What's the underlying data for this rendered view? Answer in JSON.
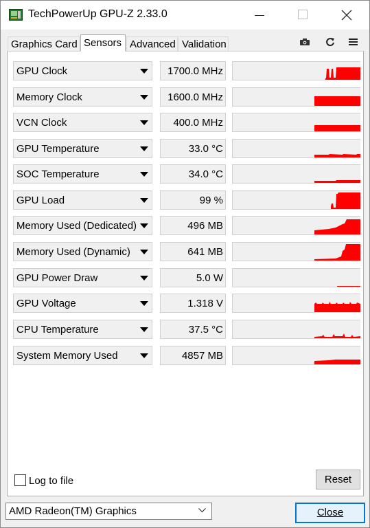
{
  "window": {
    "title": "TechPowerUp GPU-Z 2.33.0",
    "icon": "gpu-card-icon"
  },
  "tabs": [
    {
      "label": "Graphics Card",
      "active": false
    },
    {
      "label": "Sensors",
      "active": true
    },
    {
      "label": "Advanced",
      "active": false
    },
    {
      "label": "Validation",
      "active": false
    }
  ],
  "header_icons": [
    "camera-icon",
    "refresh-icon",
    "menu-icon"
  ],
  "sensors": [
    {
      "name": "GPU Clock",
      "value": "1700.0 MHz"
    },
    {
      "name": "Memory Clock",
      "value": "1600.0 MHz"
    },
    {
      "name": "VCN Clock",
      "value": "400.0 MHz"
    },
    {
      "name": "GPU Temperature",
      "value": "33.0 °C"
    },
    {
      "name": "SOC Temperature",
      "value": "34.0 °C"
    },
    {
      "name": "GPU Load",
      "value": "99 %"
    },
    {
      "name": "Memory Used (Dedicated)",
      "value": "496 MB"
    },
    {
      "name": "Memory Used (Dynamic)",
      "value": "641 MB"
    },
    {
      "name": "GPU Power Draw",
      "value": "5.0 W"
    },
    {
      "name": "GPU Voltage",
      "value": "1.318 V"
    },
    {
      "name": "CPU Temperature",
      "value": "37.5 °C"
    },
    {
      "name": "System Memory Used",
      "value": "4857 MB"
    }
  ],
  "graph_color": "#ff0000",
  "log_to_file": {
    "label": "Log to file",
    "checked": false
  },
  "reset_label": "Reset",
  "gpu_select": {
    "value": "AMD Radeon(TM) Graphics"
  },
  "close_label": "Close"
}
